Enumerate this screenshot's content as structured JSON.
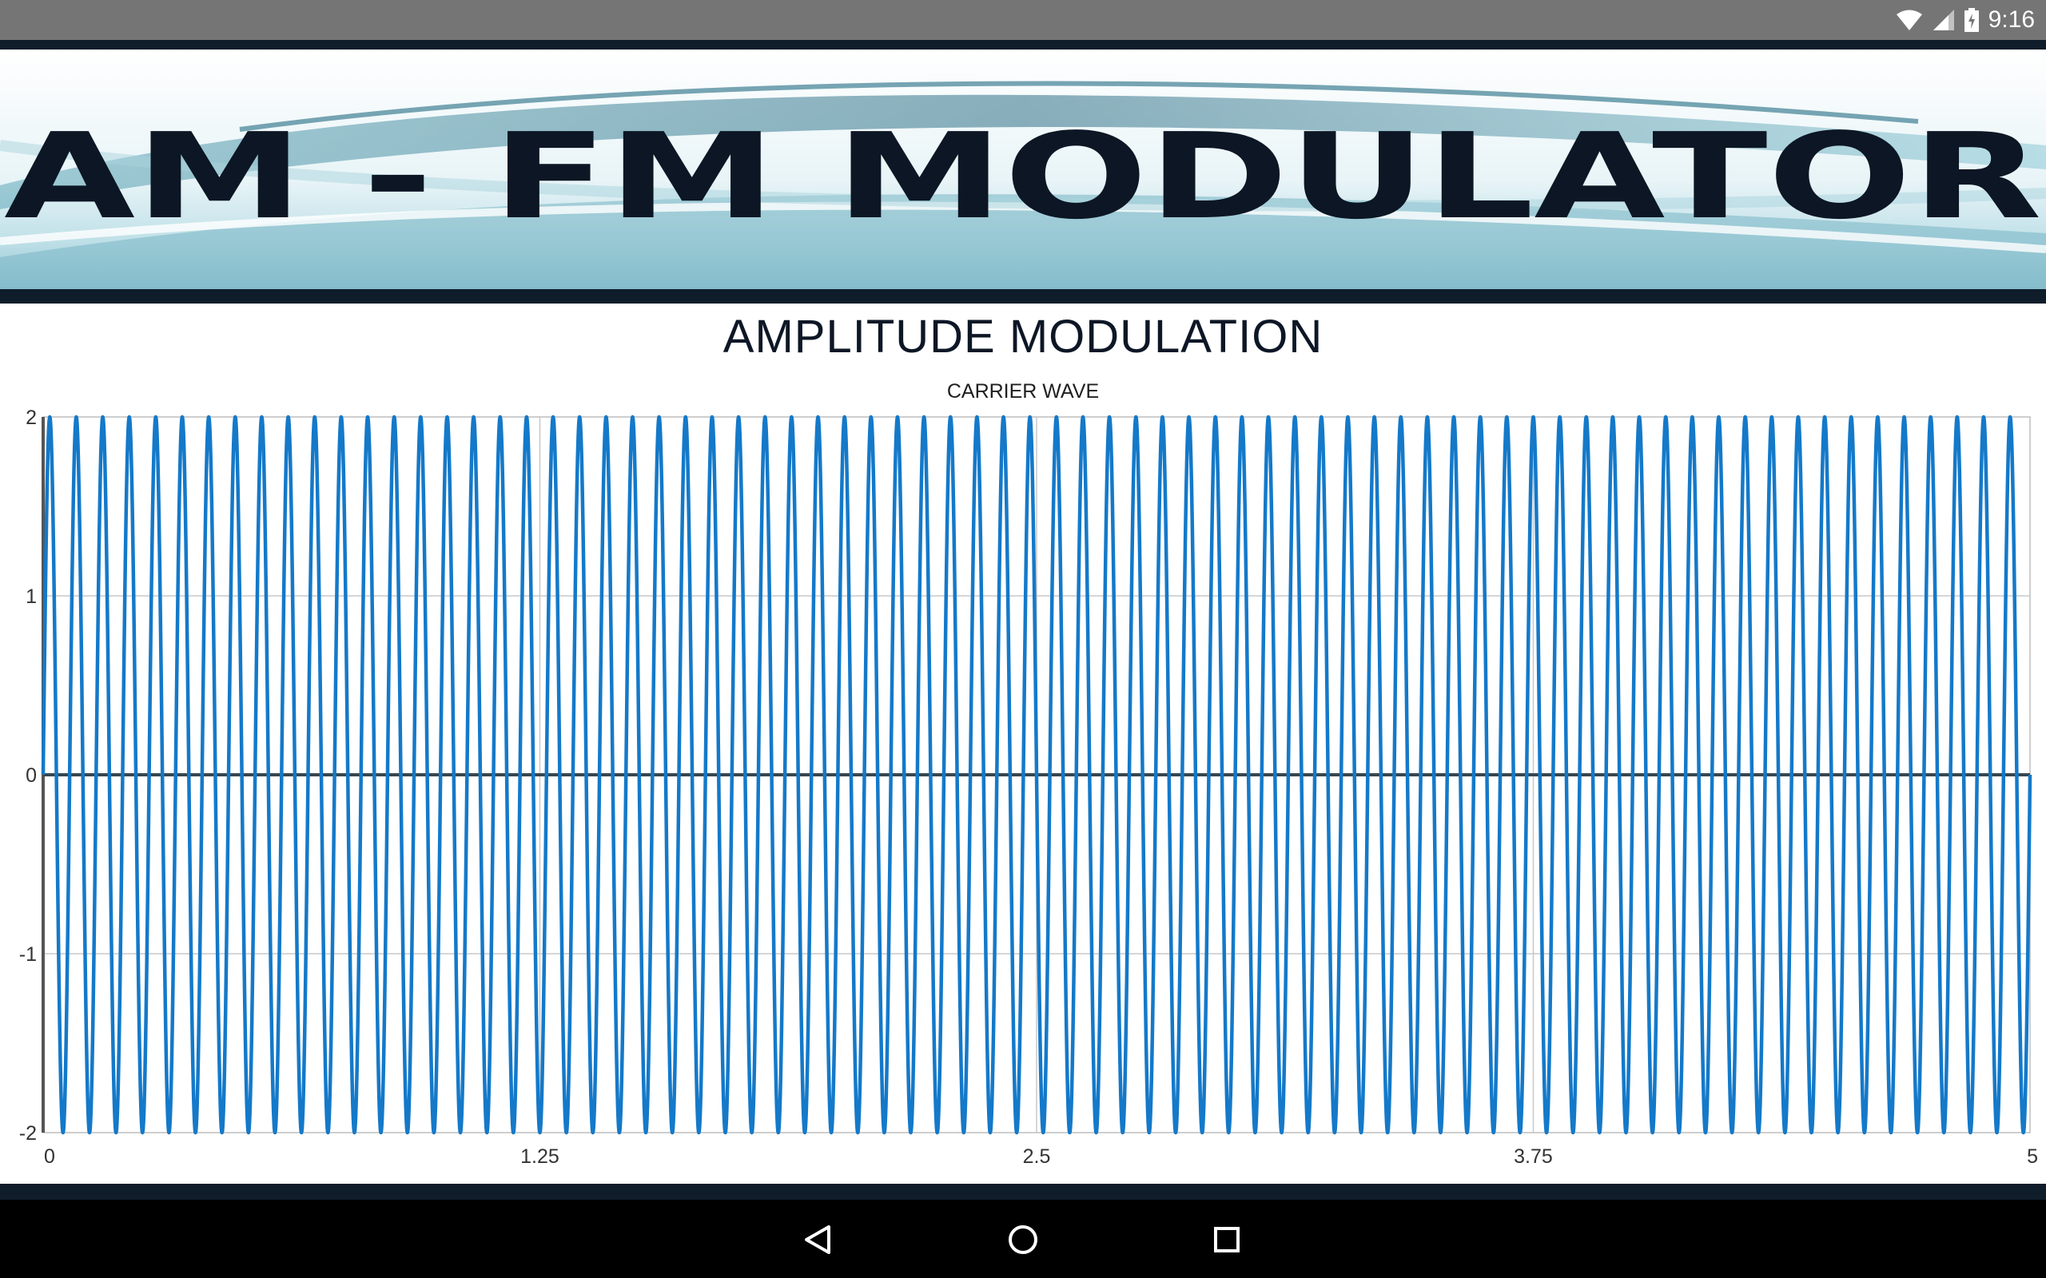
{
  "status_bar": {
    "time": "9:16",
    "icons": [
      "wifi-icon",
      "cellular-signal-icon",
      "battery-charging-icon"
    ]
  },
  "banner": {
    "text": "AM - FM MODULATOR"
  },
  "page": {
    "title": "AMPLITUDE MODULATION"
  },
  "chart_data": {
    "type": "line",
    "title": "CARRIER WAVE",
    "xlabel": "",
    "ylabel": "",
    "xlim": [
      0,
      5
    ],
    "ylim": [
      -2,
      2
    ],
    "x_ticks": [
      "0",
      "1.25",
      "2.5",
      "3.75",
      "5"
    ],
    "y_ticks": [
      "2",
      "1",
      "0",
      "-1",
      "-2"
    ],
    "grid": true,
    "series": [
      {
        "function": "2*sin(2*pi*15*x)",
        "amplitude": 2,
        "frequency": 15,
        "color": "#1479c9"
      }
    ]
  },
  "nav_bar": {
    "buttons": [
      "back-icon",
      "home-icon",
      "recents-icon"
    ]
  }
}
